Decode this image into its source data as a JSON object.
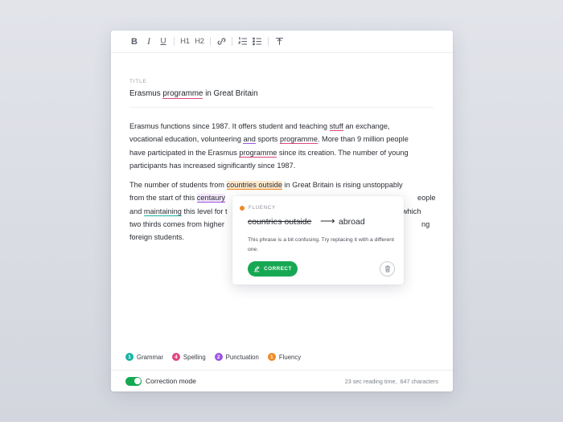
{
  "toolbar": {
    "bold": "B",
    "italic": "I",
    "underline": "U",
    "h1": "H1",
    "h2": "H2"
  },
  "document": {
    "title_label": "TITLE",
    "title_parts": [
      "Erasmus ",
      "programme",
      " in Great Britain"
    ],
    "p1": {
      "l1a": "Erasmus functions since 1987. It offers student and teaching ",
      "l1b": "stuff",
      "l1c": " an exchange,",
      "l2a": "vocational education, volunteering ",
      "l2b": "and",
      "l2c": " sports ",
      "l2d": "programme",
      "l2e": ". More than 9 million people",
      "l3a": "have participated in the Erasmus ",
      "l3b": "programme",
      "l3c": " since its creation. The number of young",
      "l4": "participants has increased significantly since 1987."
    },
    "p2": {
      "l1a": "The number of students from ",
      "l1b": "countries outside",
      "l1c": " in Great Britain is rising unstoppably",
      "l2a": "from the start of this ",
      "l2b": "centaury",
      "l2c": "eople",
      "l3a": "and ",
      "l3b": "maintaining",
      "l3c": " this level for t",
      "l3d": "which",
      "l4a": "two thirds comes from higher ",
      "l4b": "ng",
      "l5": "foreign students."
    }
  },
  "popup": {
    "category": "FLUENCY",
    "original": "countries outside",
    "arrow": "⟶",
    "replacement": "abroad",
    "message": "This phrase is a bit confusing. Try replacing it with a different one.",
    "correct_label": "CORRECT"
  },
  "legend": [
    {
      "count": "1",
      "label": "Grammar",
      "color": "#18b3a0"
    },
    {
      "count": "4",
      "label": "Spelling",
      "color": "#e0467f"
    },
    {
      "count": "2",
      "label": "Punctuation",
      "color": "#9b54e0"
    },
    {
      "count": "1",
      "label": "Fluency",
      "color": "#f08a24"
    }
  ],
  "footer": {
    "mode_label": "Correction mode",
    "mode_on": true,
    "reading_time": "23 sec reading time,",
    "characters": "647 characters"
  },
  "colors": {
    "accent_green": "#17a854",
    "fluency": "#f08a24",
    "spelling": "#e0467f",
    "punctuation": "#9b54e0",
    "grammar": "#18b3a0"
  }
}
